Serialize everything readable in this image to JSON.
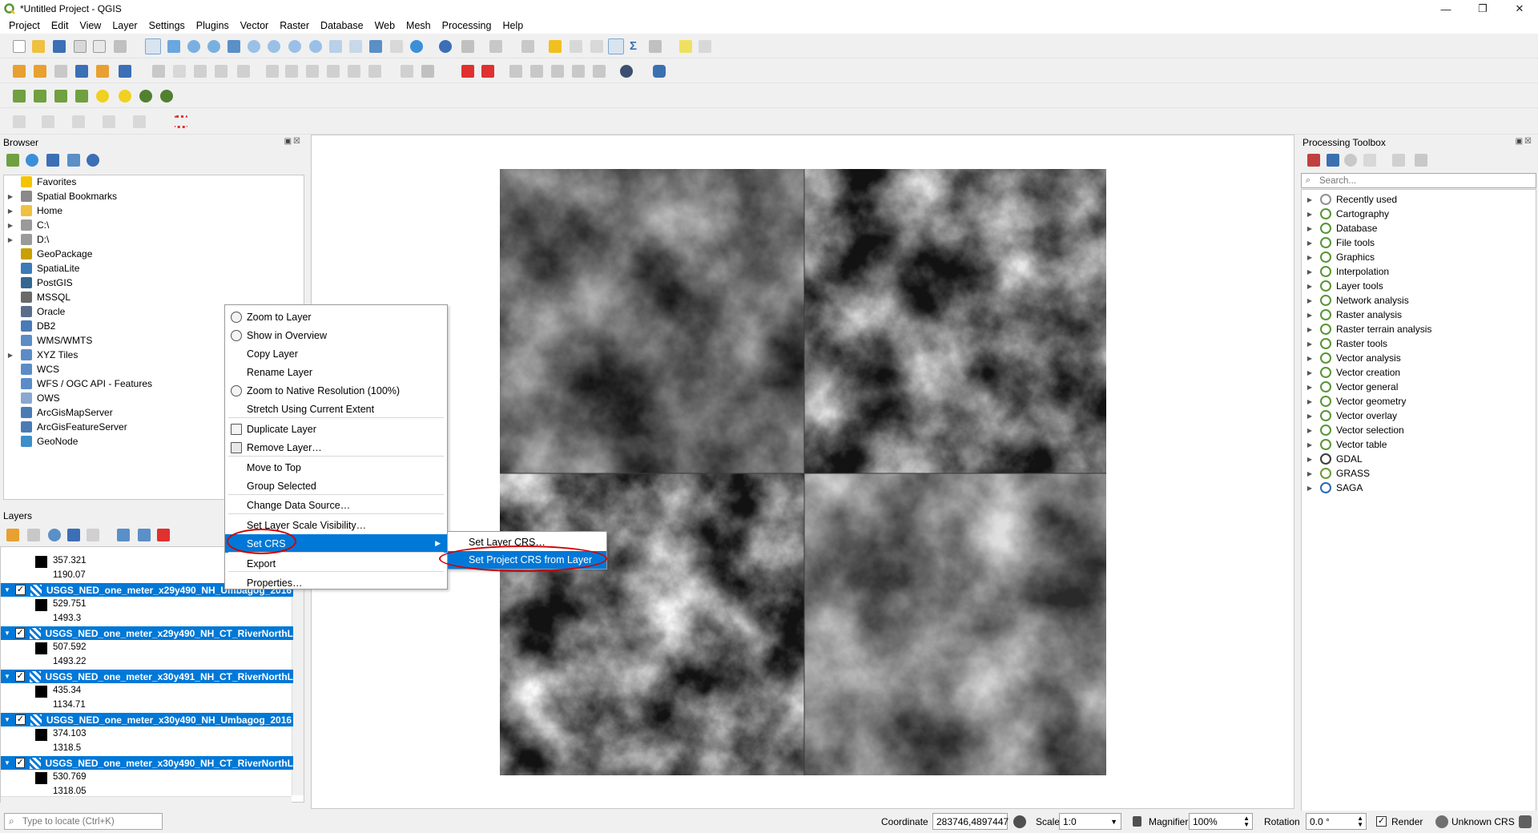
{
  "window": {
    "title": "*Untitled Project - QGIS",
    "controls": [
      "—",
      "❐",
      "✕"
    ]
  },
  "menubar": [
    "Project",
    "Edit",
    "View",
    "Layer",
    "Settings",
    "Plugins",
    "Vector",
    "Raster",
    "Database",
    "Web",
    "Mesh",
    "Processing",
    "Help"
  ],
  "browser": {
    "title": "Browser",
    "items": [
      {
        "label": "Favorites",
        "icon": "star-icon",
        "color": "#f5c400",
        "expandable": false
      },
      {
        "label": "Spatial Bookmarks",
        "icon": "bookmark-icon",
        "color": "#8a8a8a",
        "expandable": true
      },
      {
        "label": "Home",
        "icon": "folder-icon",
        "color": "#f0c040",
        "expandable": true
      },
      {
        "label": "C:\\",
        "icon": "drive-icon",
        "color": "#9a9a9a",
        "expandable": true
      },
      {
        "label": "D:\\",
        "icon": "drive-icon",
        "color": "#9a9a9a",
        "expandable": true
      },
      {
        "label": "GeoPackage",
        "icon": "geopackage-icon",
        "color": "#c8a000",
        "expandable": false
      },
      {
        "label": "SpatiaLite",
        "icon": "spatialite-icon",
        "color": "#3d7ab8",
        "expandable": false
      },
      {
        "label": "PostGIS",
        "icon": "postgis-icon",
        "color": "#336791",
        "expandable": false
      },
      {
        "label": "MSSQL",
        "icon": "mssql-icon",
        "color": "#6a6a6a",
        "expandable": false
      },
      {
        "label": "Oracle",
        "icon": "oracle-icon",
        "color": "#5a6e8c",
        "expandable": false
      },
      {
        "label": "DB2",
        "icon": "db2-icon",
        "color": "#4a7bb5",
        "expandable": false
      },
      {
        "label": "WMS/WMTS",
        "icon": "globe-icon",
        "color": "#5b8cc7",
        "expandable": false
      },
      {
        "label": "XYZ Tiles",
        "icon": "tiles-icon",
        "color": "#5b8cc7",
        "expandable": true
      },
      {
        "label": "WCS",
        "icon": "globe-icon",
        "color": "#5b8cc7",
        "expandable": false
      },
      {
        "label": "WFS / OGC API - Features",
        "icon": "globe-icon",
        "color": "#5b8cc7",
        "expandable": false
      },
      {
        "label": "OWS",
        "icon": "globe-icon",
        "color": "#8aa8d0",
        "expandable": false
      },
      {
        "label": "ArcGisMapServer",
        "icon": "arcgis-icon",
        "color": "#4a7bb5",
        "expandable": false
      },
      {
        "label": "ArcGisFeatureServer",
        "icon": "arcgis-icon",
        "color": "#4a7bb5",
        "expandable": false
      },
      {
        "label": "GeoNode",
        "icon": "geonode-icon",
        "color": "#3d8ec9",
        "expandable": false
      }
    ]
  },
  "layers": {
    "title": "Layers",
    "top_values": [
      "357.321",
      "1190.07"
    ],
    "items": [
      {
        "name": "USGS_NED_one_meter_x29y490_NH_Umbagog_2016",
        "min": "529.751",
        "max": "1493.3"
      },
      {
        "name": "USGS_NED_one_meter_x29y490_NH_CT_RiverNorthL",
        "min": "507.592",
        "max": "1493.22"
      },
      {
        "name": "USGS_NED_one_meter_x30y491_NH_CT_RiverNorthL",
        "min": "435.34",
        "max": "1134.71"
      },
      {
        "name": "USGS_NED_one_meter_x30y490_NH_Umbagog_2016",
        "min": "374.103",
        "max": "1318.5"
      },
      {
        "name": "USGS_NED_one_meter_x30y490_NH_CT_RiverNorthL",
        "min": "530.769",
        "max": "1318.05"
      }
    ]
  },
  "context_menu": {
    "items": [
      "Zoom to Layer",
      "Show in Overview",
      "Copy Layer",
      "Rename Layer",
      "Zoom to Native Resolution (100%)",
      "Stretch Using Current Extent",
      "Duplicate Layer",
      "Remove Layer…",
      "Move to Top",
      "Group Selected",
      "Change Data Source…",
      "Set Layer Scale Visibility…",
      "Set CRS",
      "Export",
      "Properties…"
    ],
    "submenu": [
      "Set Layer CRS…",
      "Set Project CRS from Layer"
    ]
  },
  "processing": {
    "title": "Processing Toolbox",
    "search_placeholder": "Search...",
    "items": [
      {
        "label": "Recently used",
        "icon": "clock-icon"
      },
      {
        "label": "Cartography",
        "icon": "qgis-icon"
      },
      {
        "label": "Database",
        "icon": "qgis-icon"
      },
      {
        "label": "File tools",
        "icon": "qgis-icon"
      },
      {
        "label": "Graphics",
        "icon": "qgis-icon"
      },
      {
        "label": "Interpolation",
        "icon": "qgis-icon"
      },
      {
        "label": "Layer tools",
        "icon": "qgis-icon"
      },
      {
        "label": "Network analysis",
        "icon": "qgis-icon"
      },
      {
        "label": "Raster analysis",
        "icon": "qgis-icon"
      },
      {
        "label": "Raster terrain analysis",
        "icon": "qgis-icon"
      },
      {
        "label": "Raster tools",
        "icon": "qgis-icon"
      },
      {
        "label": "Vector analysis",
        "icon": "qgis-icon"
      },
      {
        "label": "Vector creation",
        "icon": "qgis-icon"
      },
      {
        "label": "Vector general",
        "icon": "qgis-icon"
      },
      {
        "label": "Vector geometry",
        "icon": "qgis-icon"
      },
      {
        "label": "Vector overlay",
        "icon": "qgis-icon"
      },
      {
        "label": "Vector selection",
        "icon": "qgis-icon"
      },
      {
        "label": "Vector table",
        "icon": "qgis-icon"
      },
      {
        "label": "GDAL",
        "icon": "gdal-icon"
      },
      {
        "label": "GRASS",
        "icon": "grass-icon"
      },
      {
        "label": "SAGA",
        "icon": "saga-icon"
      }
    ]
  },
  "statusbar": {
    "locate_placeholder": "Type to locate (Ctrl+K)",
    "coordinate_label": "Coordinate",
    "coordinate_value": "283746,4897447",
    "scale_label": "Scale",
    "scale_value": "1:0",
    "magnifier_label": "Magnifier",
    "magnifier_value": "100%",
    "rotation_label": "Rotation",
    "rotation_value": "0.0 °",
    "render_label": "Render",
    "crs_label": "Unknown CRS"
  },
  "colors": {
    "selection": "#0078d7",
    "highlight_ellipse": "#d10000",
    "qgis_green": "#589632"
  }
}
